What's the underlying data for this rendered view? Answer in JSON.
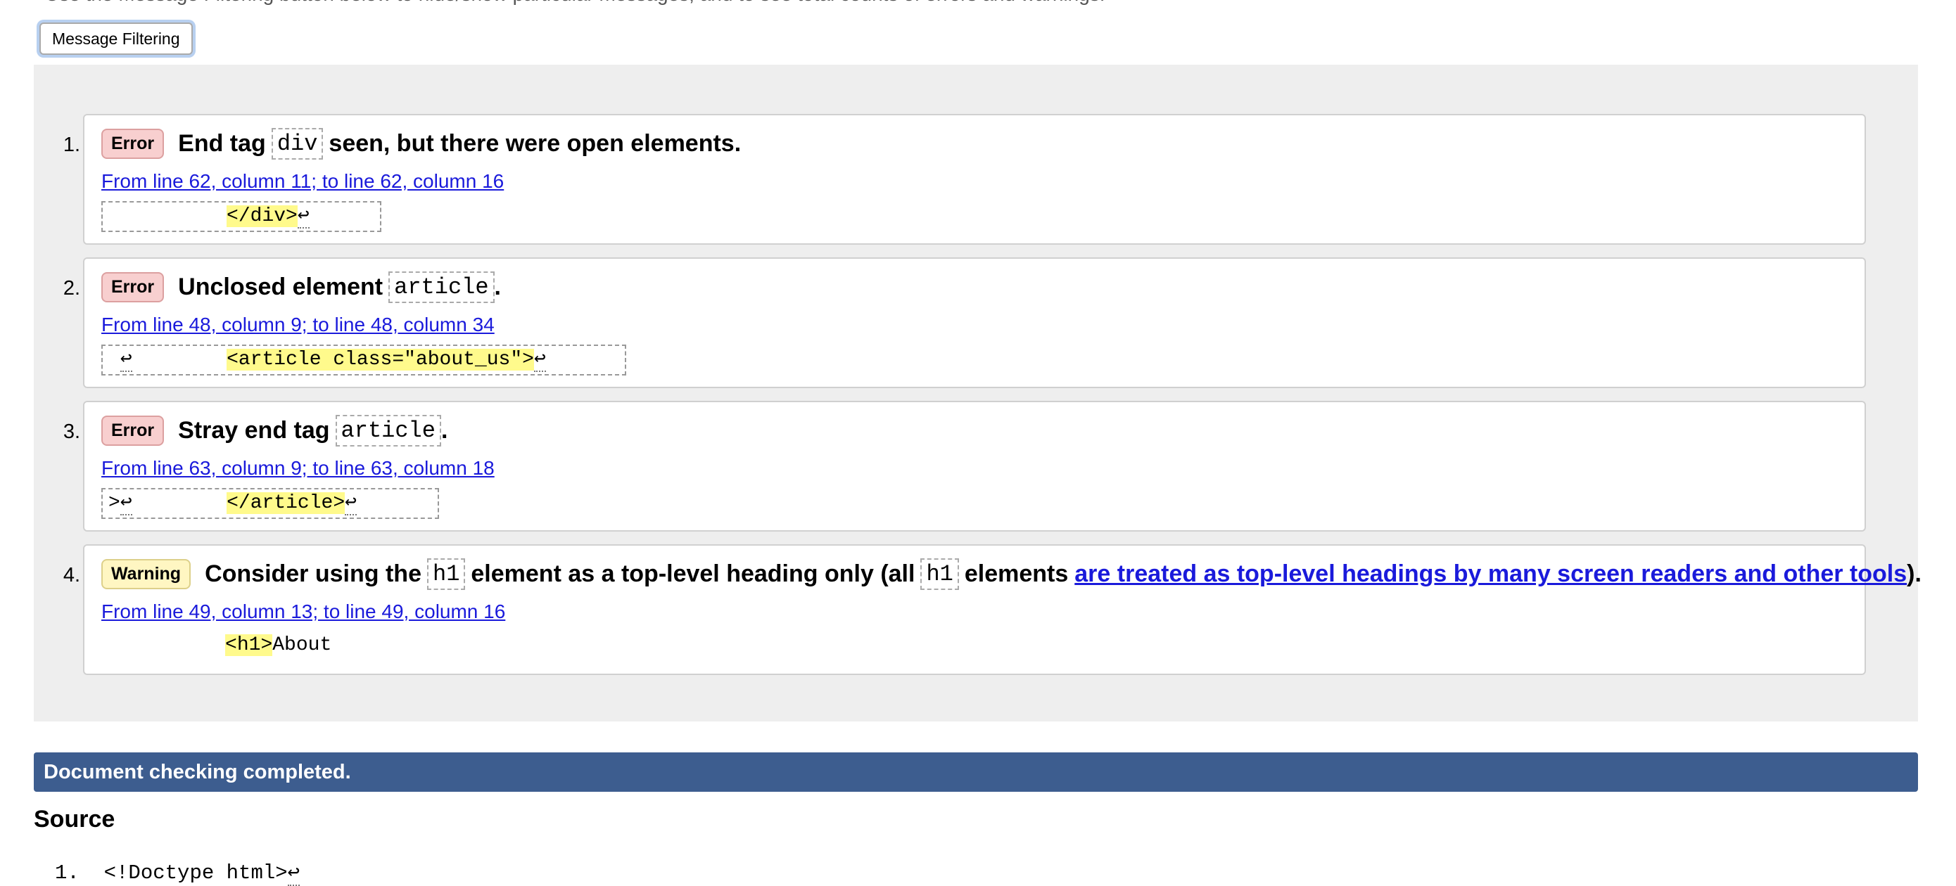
{
  "intro_text": "Use the Message Filtering button below to hide/show particular messages, and to see total counts of errors and warnings.",
  "filter_button": "Message Filtering",
  "messages": [
    {
      "num": "1.",
      "type": "Error",
      "pre": "End tag",
      "code": "div",
      "post": "seen, but there were open elements.",
      "location": "From line 62, column 11; to line 62, column 16",
      "extract_pre": "          ",
      "extract_hl": "</div>",
      "extract_post": ""
    },
    {
      "num": "2.",
      "type": "Error",
      "pre": "Unclosed element",
      "code": "article",
      "post": ".",
      "location": "From line 48, column 9; to line 48, column 34",
      "extract_pre": "        ",
      "extract_hl": "<article class=\"about_us\">",
      "extract_post": ""
    },
    {
      "num": "3.",
      "type": "Error",
      "pre": "Stray end tag",
      "code": "article",
      "post": ".",
      "location": "From line 63, column 9; to line 63, column 18",
      "extract_pre": "        ",
      "extract_hl": "</article>",
      "extract_post": ""
    },
    {
      "num": "4.",
      "type": "Warning",
      "pre": "Consider using the",
      "code": "h1",
      "mid": "element as a top-level heading only (all",
      "code2": "h1",
      "mid2": "elements",
      "link": "are treated as top-level headings by many screen readers and other tools",
      "post": ").",
      "location": "From line 49, column 13; to line 49, column 16",
      "extract_pre": "          ",
      "extract_hl": "<h1>",
      "extract_post": "About"
    }
  ],
  "return_glyph": "↩",
  "extract_prefix_2": " ",
  "extract_prefix_3": ">",
  "status_text": "Document checking completed.",
  "source_heading": "Source",
  "source_first_line": {
    "num": "1.",
    "text": "<!Doctype html>"
  }
}
